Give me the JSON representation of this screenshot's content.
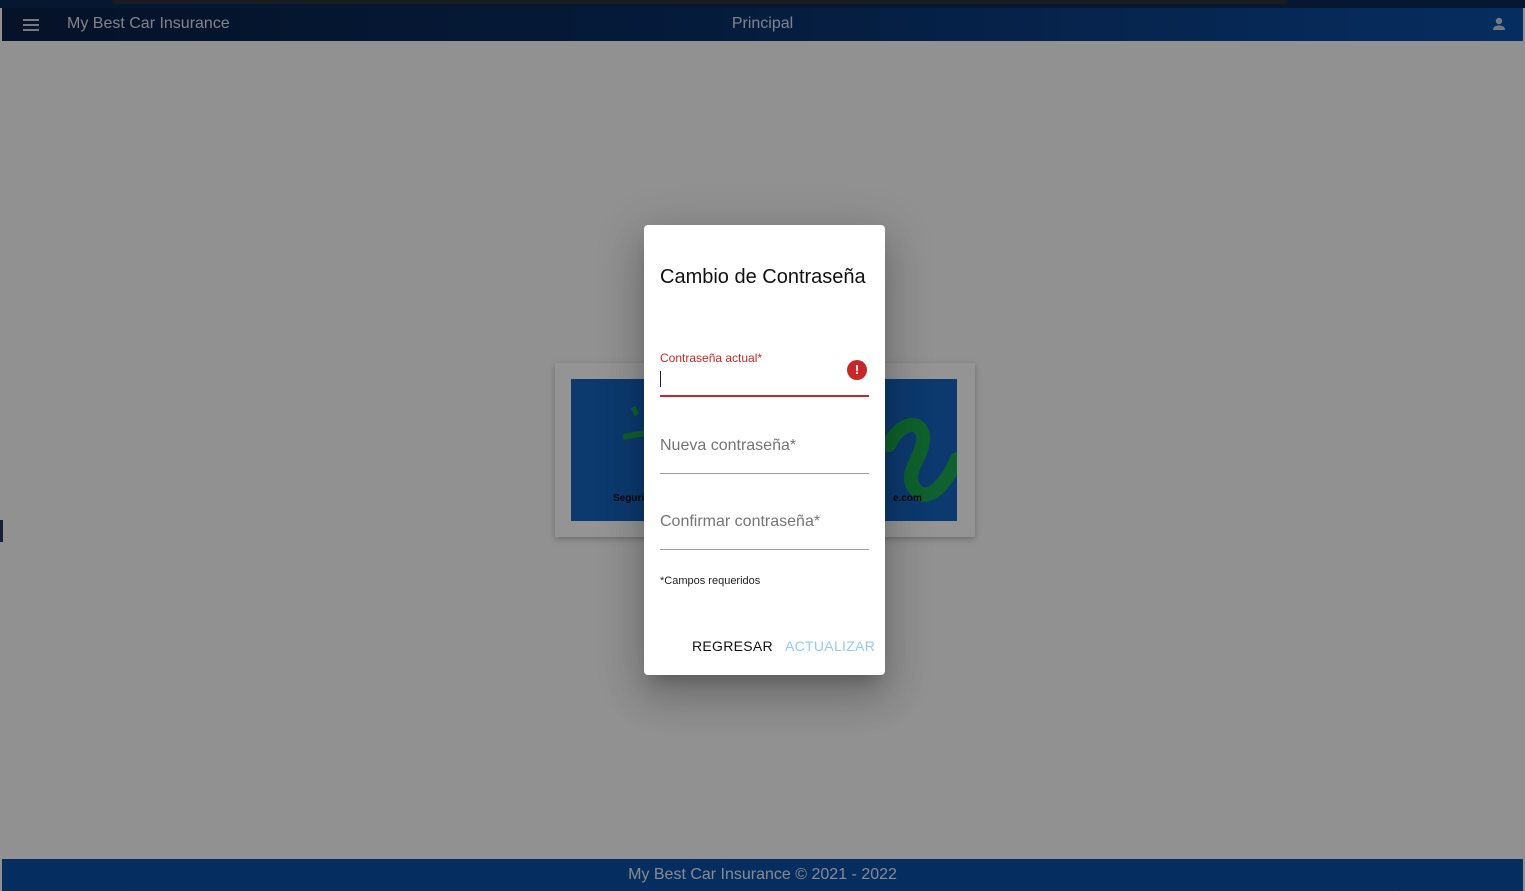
{
  "header": {
    "app_title": "My Best Car Insurance",
    "page_title": "Principal"
  },
  "banner": {
    "left_text": "Seguri",
    "right_text": "e.com"
  },
  "footer": {
    "text": "My Best Car Insurance © 2021 - 2022"
  },
  "dialog": {
    "title": "Cambio de Contraseña",
    "current_password": {
      "label": "Contraseña actual*",
      "value": "",
      "error": true
    },
    "new_password": {
      "label": "Nueva contraseña*",
      "value": ""
    },
    "confirm_password": {
      "label": "Confirmar contraseña*",
      "value": ""
    },
    "required_note": "*Campos requeridos",
    "back_label": "REGRESAR",
    "update_label": "ACTUALIZAR"
  },
  "colors": {
    "toolbar_start": "#0a1f44",
    "toolbar_end": "#0b4fa6",
    "footer": "#0b4fa6",
    "error": "#c62828",
    "update_button": "#90caf9"
  },
  "icons": [
    "menu-icon",
    "user-icon",
    "error-icon"
  ]
}
